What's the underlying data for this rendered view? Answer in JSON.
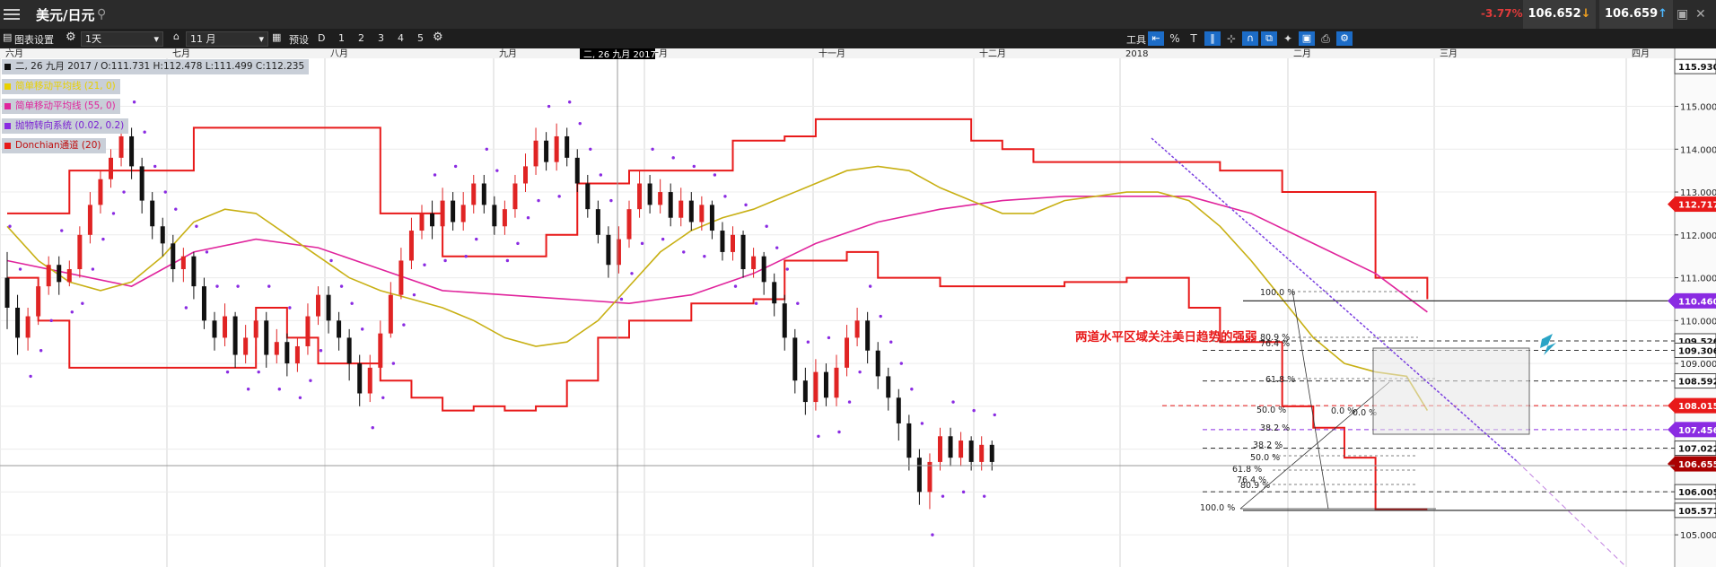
{
  "header": {
    "symbol": "美元/日元",
    "change_pct": "-3.77%",
    "bid": "106.652",
    "ask": "106.659"
  },
  "toolbar": {
    "chart_settings": "图表设置",
    "interval": "1天",
    "count": "11 月",
    "preset_label": "预设",
    "presets": [
      "D",
      "1",
      "2",
      "3",
      "4",
      "5"
    ],
    "tools_label": "工具"
  },
  "legend": {
    "ohlc": "二, 26 九月 2017 / O:111.731  H:112.478  L:111.499  C:112.235",
    "ma21": "简单移动平均线 (21, 0)",
    "ma55": "简单移动平均线 (55, 0)",
    "sar": "抛物转向系统 (0.02, 0.2)",
    "donchian": "Donchian通道 (20)"
  },
  "crosshair_label": "二, 26 九月 2017",
  "annotation": "两道水平区域关注美日趋势的强弱",
  "fib_labels": [
    "100.0 %",
    "80.9 %",
    "76.4 %",
    "61.8 %",
    "50.0 %",
    "38.2 %",
    "0.0 %"
  ],
  "colors": {
    "candle_up": "#e02424",
    "candle_down": "#111111",
    "ma21": "#c8b014",
    "ma55": "#e0249c",
    "sar": "#8a2be2",
    "donchian": "#e81a1a",
    "title_bar": "#2b2b2b",
    "tool_icon": "#1c6cc7"
  },
  "chart_data": {
    "type": "candlestick",
    "x_labels": [
      "六月",
      "七月",
      "八月",
      "九月",
      "十月",
      "十一月",
      "十二月",
      "2018",
      "二月",
      "三月",
      "四月"
    ],
    "y_ticks": [
      105.0,
      106.0,
      107.0,
      108.0,
      109.0,
      110.0,
      111.0,
      112.0,
      113.0,
      114.0,
      115.0
    ],
    "ylim": [
      104.5,
      116.1
    ],
    "price_tags": [
      {
        "value": "115.930",
        "style": "plain"
      },
      {
        "value": "112.717",
        "style": "red"
      },
      {
        "value": "110.460",
        "style": "purple"
      },
      {
        "value": "109.526",
        "style": "plain"
      },
      {
        "value": "109.306",
        "style": "plain"
      },
      {
        "value": "108.592",
        "style": "plain"
      },
      {
        "value": "108.015",
        "style": "red"
      },
      {
        "value": "107.456",
        "style": "purple"
      },
      {
        "value": "107.022",
        "style": "plain"
      },
      {
        "value": "106.6555",
        "style": "darkred"
      },
      {
        "value": "106.005",
        "style": "plain"
      },
      {
        "value": "105.571",
        "style": "plain"
      }
    ],
    "horizontal_levels": [
      110.46,
      109.526,
      109.306,
      108.592,
      108.015,
      107.456,
      107.022,
      106.005,
      105.571
    ],
    "ma21_curve": [
      [
        0,
        112.2
      ],
      [
        3,
        111.4
      ],
      [
        6,
        110.9
      ],
      [
        9,
        110.7
      ],
      [
        12,
        110.9
      ],
      [
        15,
        111.5
      ],
      [
        18,
        112.3
      ],
      [
        21,
        112.6
      ],
      [
        24,
        112.5
      ],
      [
        27,
        112.0
      ],
      [
        30,
        111.5
      ],
      [
        33,
        111.0
      ],
      [
        36,
        110.7
      ],
      [
        39,
        110.5
      ],
      [
        42,
        110.3
      ],
      [
        45,
        110.0
      ],
      [
        48,
        109.6
      ],
      [
        51,
        109.4
      ],
      [
        54,
        109.5
      ],
      [
        57,
        110.0
      ],
      [
        60,
        110.8
      ],
      [
        63,
        111.6
      ],
      [
        66,
        112.1
      ],
      [
        69,
        112.4
      ],
      [
        72,
        112.6
      ],
      [
        75,
        112.9
      ],
      [
        78,
        113.2
      ],
      [
        81,
        113.5
      ],
      [
        84,
        113.6
      ],
      [
        87,
        113.5
      ],
      [
        90,
        113.1
      ],
      [
        93,
        112.8
      ],
      [
        96,
        112.5
      ],
      [
        99,
        112.5
      ],
      [
        102,
        112.8
      ],
      [
        105,
        112.9
      ],
      [
        108,
        113.0
      ],
      [
        111,
        113.0
      ],
      [
        114,
        112.8
      ],
      [
        117,
        112.2
      ],
      [
        120,
        111.4
      ],
      [
        123,
        110.5
      ],
      [
        126,
        109.6
      ],
      [
        129,
        109.0
      ],
      [
        132,
        108.8
      ],
      [
        135,
        108.7
      ],
      [
        137,
        107.9
      ]
    ],
    "ma55_curve": [
      [
        0,
        111.4
      ],
      [
        6,
        111.1
      ],
      [
        12,
        110.8
      ],
      [
        18,
        111.6
      ],
      [
        24,
        111.9
      ],
      [
        30,
        111.7
      ],
      [
        36,
        111.2
      ],
      [
        42,
        110.7
      ],
      [
        48,
        110.6
      ],
      [
        54,
        110.5
      ],
      [
        60,
        110.4
      ],
      [
        66,
        110.6
      ],
      [
        72,
        111.1
      ],
      [
        78,
        111.8
      ],
      [
        84,
        112.3
      ],
      [
        90,
        112.6
      ],
      [
        96,
        112.8
      ],
      [
        102,
        112.9
      ],
      [
        108,
        112.9
      ],
      [
        114,
        112.9
      ],
      [
        120,
        112.5
      ],
      [
        126,
        111.8
      ],
      [
        132,
        111.1
      ],
      [
        137,
        110.2
      ]
    ],
    "donchian_upper": [
      [
        0,
        112.5
      ],
      [
        6,
        113.5
      ],
      [
        13,
        113.5
      ],
      [
        18,
        114.5
      ],
      [
        30,
        114.5
      ],
      [
        36,
        112.5
      ],
      [
        42,
        111.5
      ],
      [
        49,
        111.5
      ],
      [
        52,
        112.0
      ],
      [
        55,
        113.2
      ],
      [
        60,
        113.5
      ],
      [
        66,
        113.5
      ],
      [
        70,
        114.2
      ],
      [
        75,
        114.3
      ],
      [
        78,
        114.7
      ],
      [
        90,
        114.7
      ],
      [
        93,
        114.2
      ],
      [
        96,
        114.0
      ],
      [
        99,
        113.7
      ],
      [
        114,
        113.7
      ],
      [
        117,
        113.5
      ],
      [
        123,
        113.0
      ],
      [
        129,
        113.0
      ],
      [
        132,
        111.0
      ],
      [
        137,
        110.5
      ]
    ],
    "donchian_lower": [
      [
        0,
        111.0
      ],
      [
        3,
        110.0
      ],
      [
        6,
        108.9
      ],
      [
        18,
        108.9
      ],
      [
        24,
        110.3
      ],
      [
        27,
        109.6
      ],
      [
        30,
        109.0
      ],
      [
        36,
        108.6
      ],
      [
        39,
        108.2
      ],
      [
        42,
        107.9
      ],
      [
        45,
        108.0
      ],
      [
        48,
        107.9
      ],
      [
        51,
        108.0
      ],
      [
        54,
        108.6
      ],
      [
        57,
        109.6
      ],
      [
        60,
        110.0
      ],
      [
        66,
        110.4
      ],
      [
        72,
        110.5
      ],
      [
        75,
        111.4
      ],
      [
        81,
        111.6
      ],
      [
        84,
        111.0
      ],
      [
        90,
        110.8
      ],
      [
        96,
        110.8
      ],
      [
        102,
        110.9
      ],
      [
        108,
        111.0
      ],
      [
        111,
        111.0
      ],
      [
        114,
        110.3
      ],
      [
        117,
        109.5
      ],
      [
        123,
        108.0
      ],
      [
        126,
        107.5
      ],
      [
        129,
        106.8
      ],
      [
        132,
        105.6
      ],
      [
        137,
        105.6
      ]
    ],
    "candles": [
      [
        0,
        111.0,
        110.3,
        111.6,
        109.8
      ],
      [
        1,
        110.3,
        109.6,
        110.6,
        109.2
      ],
      [
        2,
        109.6,
        110.1,
        110.3,
        109.3
      ],
      [
        3,
        110.1,
        110.8,
        111.0,
        109.9
      ],
      [
        4,
        110.8,
        111.3,
        111.5,
        110.6
      ],
      [
        5,
        111.3,
        110.9,
        111.5,
        110.6
      ],
      [
        6,
        110.9,
        111.2,
        111.4,
        110.8
      ],
      [
        7,
        111.2,
        112.0,
        112.2,
        111.0
      ],
      [
        8,
        112.0,
        112.7,
        113.0,
        111.8
      ],
      [
        9,
        112.7,
        113.3,
        113.5,
        112.5
      ],
      [
        10,
        113.3,
        113.8,
        114.0,
        113.1
      ],
      [
        11,
        113.8,
        114.3,
        114.5,
        113.6
      ],
      [
        12,
        114.3,
        113.6,
        114.5,
        113.3
      ],
      [
        13,
        113.6,
        112.8,
        113.8,
        112.5
      ],
      [
        14,
        112.8,
        112.2,
        113.0,
        111.9
      ],
      [
        15,
        112.2,
        111.8,
        112.4,
        111.5
      ],
      [
        16,
        111.8,
        111.2,
        112.0,
        110.9
      ],
      [
        17,
        111.2,
        111.5,
        111.7,
        110.9
      ],
      [
        18,
        111.5,
        110.8,
        111.6,
        110.5
      ],
      [
        19,
        110.8,
        110.0,
        111.0,
        109.8
      ],
      [
        20,
        110.0,
        109.6,
        110.2,
        109.3
      ],
      [
        21,
        109.6,
        110.1,
        110.4,
        109.4
      ],
      [
        22,
        110.1,
        109.2,
        110.2,
        108.9
      ],
      [
        23,
        109.2,
        109.6,
        109.9,
        109.0
      ],
      [
        24,
        109.6,
        110.0,
        110.3,
        109.4
      ],
      [
        25,
        110.0,
        109.2,
        110.2,
        108.9
      ],
      [
        26,
        109.2,
        109.5,
        109.8,
        109.0
      ],
      [
        27,
        109.5,
        109.0,
        109.7,
        108.7
      ],
      [
        28,
        109.0,
        109.4,
        109.6,
        108.8
      ],
      [
        29,
        109.4,
        110.1,
        110.4,
        109.2
      ],
      [
        30,
        110.1,
        110.6,
        110.8,
        109.9
      ],
      [
        31,
        110.6,
        110.0,
        110.8,
        109.7
      ],
      [
        32,
        110.0,
        109.6,
        110.2,
        109.3
      ],
      [
        33,
        109.6,
        109.0,
        109.8,
        108.6
      ],
      [
        34,
        109.0,
        108.3,
        109.2,
        108.0
      ],
      [
        35,
        108.3,
        108.9,
        109.2,
        108.1
      ],
      [
        36,
        108.9,
        109.7,
        110.0,
        108.8
      ],
      [
        37,
        109.7,
        110.6,
        110.9,
        109.6
      ],
      [
        38,
        110.6,
        111.4,
        111.7,
        110.5
      ],
      [
        39,
        111.4,
        112.1,
        112.4,
        111.2
      ],
      [
        40,
        112.1,
        112.5,
        112.7,
        111.9
      ],
      [
        41,
        112.5,
        112.2,
        112.8,
        111.9
      ],
      [
        42,
        112.2,
        112.8,
        113.1,
        112.0
      ],
      [
        43,
        112.8,
        112.3,
        113.0,
        112.1
      ],
      [
        44,
        112.3,
        112.7,
        113.0,
        112.1
      ],
      [
        45,
        112.7,
        113.2,
        113.4,
        112.5
      ],
      [
        46,
        113.2,
        112.7,
        113.4,
        112.5
      ],
      [
        47,
        112.7,
        112.2,
        112.9,
        112.0
      ],
      [
        48,
        112.2,
        112.6,
        112.8,
        112.0
      ],
      [
        49,
        112.6,
        113.2,
        113.4,
        112.4
      ],
      [
        50,
        113.2,
        113.6,
        113.9,
        113.0
      ],
      [
        51,
        113.6,
        114.2,
        114.5,
        113.4
      ],
      [
        52,
        114.2,
        113.7,
        114.4,
        113.5
      ],
      [
        53,
        113.7,
        114.3,
        114.6,
        113.5
      ],
      [
        54,
        114.3,
        113.8,
        114.5,
        113.6
      ],
      [
        55,
        113.8,
        113.2,
        114.0,
        113.0
      ],
      [
        56,
        113.2,
        112.6,
        113.4,
        112.4
      ],
      [
        57,
        112.6,
        112.0,
        112.8,
        111.8
      ],
      [
        58,
        112.0,
        111.3,
        112.2,
        111.0
      ],
      [
        59,
        111.3,
        111.9,
        112.2,
        111.1
      ],
      [
        60,
        111.9,
        112.6,
        112.8,
        111.7
      ],
      [
        61,
        112.6,
        113.2,
        113.5,
        112.4
      ],
      [
        62,
        113.2,
        112.7,
        113.4,
        112.5
      ],
      [
        63,
        112.7,
        113.0,
        113.3,
        112.5
      ],
      [
        64,
        113.0,
        112.4,
        113.2,
        112.2
      ],
      [
        65,
        112.4,
        112.8,
        113.1,
        112.2
      ],
      [
        66,
        112.8,
        112.3,
        113.0,
        112.1
      ],
      [
        67,
        112.3,
        112.7,
        112.9,
        112.1
      ],
      [
        68,
        112.7,
        112.1,
        112.8,
        111.9
      ],
      [
        69,
        112.1,
        111.6,
        112.3,
        111.4
      ],
      [
        70,
        111.6,
        112.0,
        112.2,
        111.4
      ],
      [
        71,
        112.0,
        111.2,
        112.1,
        111.0
      ],
      [
        72,
        111.2,
        111.5,
        111.7,
        111.0
      ],
      [
        73,
        111.5,
        110.9,
        111.6,
        110.6
      ],
      [
        74,
        110.9,
        110.4,
        111.1,
        110.1
      ],
      [
        75,
        110.4,
        109.6,
        110.6,
        109.3
      ],
      [
        76,
        109.6,
        108.6,
        109.8,
        108.3
      ],
      [
        77,
        108.6,
        108.1,
        108.9,
        107.8
      ],
      [
        78,
        108.1,
        108.8,
        109.1,
        107.9
      ],
      [
        79,
        108.8,
        108.2,
        109.0,
        108.0
      ],
      [
        80,
        108.2,
        108.9,
        109.2,
        108.0
      ],
      [
        81,
        108.9,
        109.6,
        109.9,
        108.7
      ],
      [
        82,
        109.6,
        110.0,
        110.3,
        109.4
      ],
      [
        83,
        110.0,
        109.3,
        110.2,
        109.0
      ],
      [
        84,
        109.3,
        108.7,
        109.5,
        108.4
      ],
      [
        85,
        108.7,
        108.2,
        108.9,
        107.9
      ],
      [
        86,
        108.2,
        107.6,
        108.4,
        107.2
      ],
      [
        87,
        107.6,
        106.8,
        107.8,
        106.5
      ],
      [
        88,
        106.8,
        106.0,
        107.0,
        105.7
      ],
      [
        89,
        106.0,
        106.7,
        106.9,
        105.6
      ],
      [
        90,
        106.7,
        107.3,
        107.5,
        106.5
      ],
      [
        91,
        107.3,
        106.8,
        107.5,
        106.6
      ],
      [
        92,
        106.8,
        107.2,
        107.4,
        106.6
      ],
      [
        93,
        107.2,
        106.7,
        107.3,
        106.5
      ],
      [
        94,
        106.7,
        107.1,
        107.3,
        106.5
      ],
      [
        95,
        107.1,
        106.7,
        107.2,
        106.5
      ]
    ]
  }
}
